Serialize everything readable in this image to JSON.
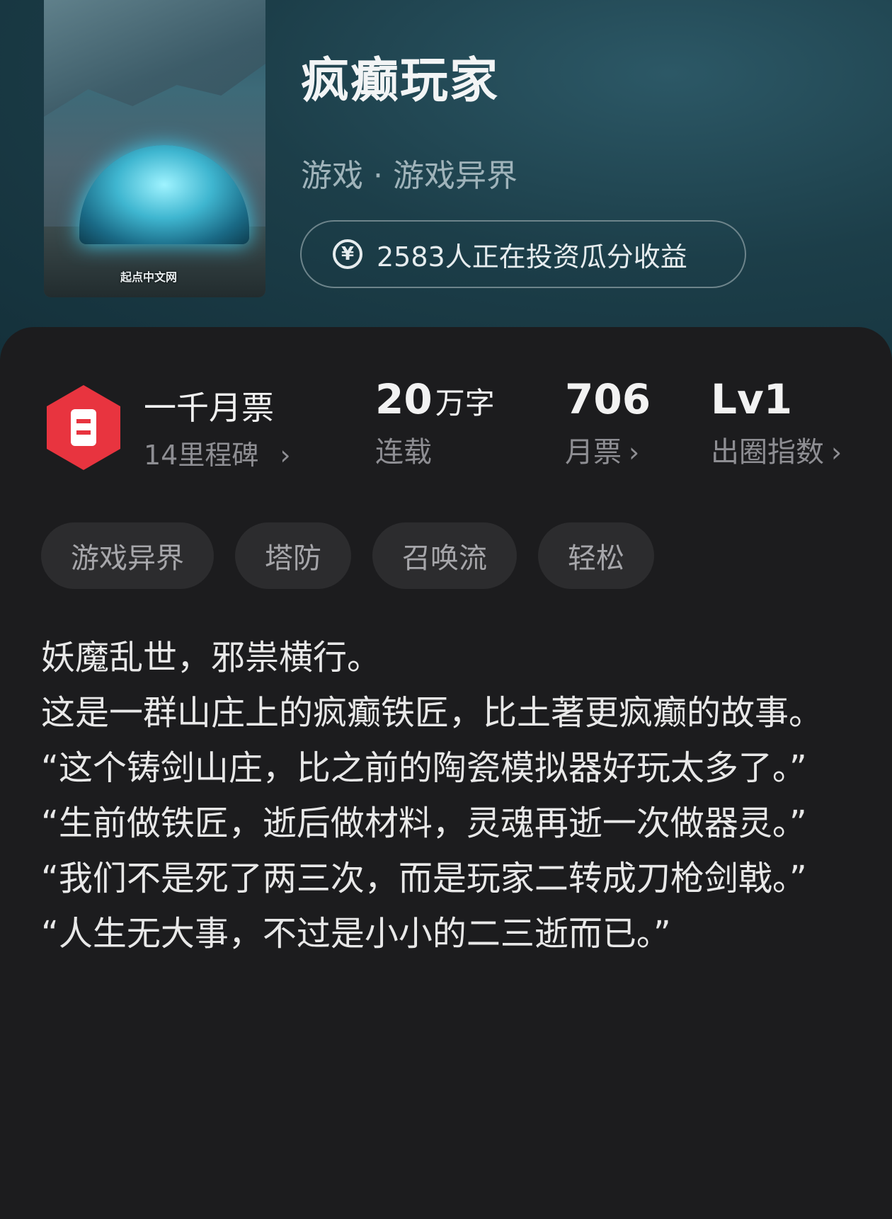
{
  "book": {
    "title": "疯癫玩家",
    "genre": "游戏 · 游戏异界",
    "cover_watermark": "起点中文网",
    "invest_text": "2583人正在投资瓜分收益"
  },
  "stats": {
    "milestone_title": "一千月票",
    "milestone_sub": "14里程碑",
    "words_value": "20",
    "words_unit": "万字",
    "words_label": "连载",
    "votes_value": "706",
    "votes_label": "月票",
    "index_value": "Lv1",
    "index_label": "出圈指数"
  },
  "tags": [
    "游戏异界",
    "塔防",
    "召唤流",
    "轻松"
  ],
  "description": [
    "妖魔乱世，邪祟横行。",
    "这是一群山庄上的疯癫铁匠，比土著更疯癫的故事。",
    "“这个铸剑山庄，比之前的陶瓷模拟器好玩太多了。”",
    "“生前做铁匠，逝后做材料，灵魂再逝一次做器灵。”",
    "“我们不是死了两三次，而是玩家二转成刀枪剑戟。”",
    "“人生无大事，不过是小小的二三逝而已。”"
  ],
  "colors": {
    "header_bg": "#1c3e49",
    "card_bg": "#1c1c1e",
    "badge_red": "#e8343f",
    "tag_bg": "#2c2c2e"
  },
  "icons": {
    "invest": "yen-circle-icon",
    "badge": "ticket-hexagon-icon",
    "chevron": "chevron-right-icon"
  }
}
